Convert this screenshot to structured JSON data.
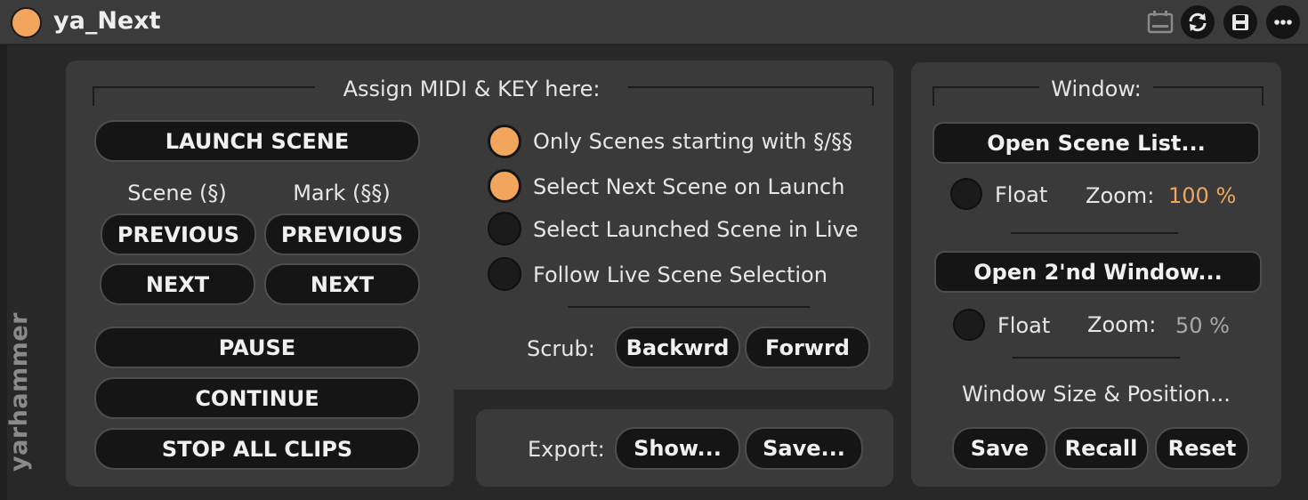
{
  "device": {
    "title": "ya_Next",
    "brand": "yarhammer"
  },
  "colors": {
    "accent": "#f2a55c",
    "panel": "#3a3a3a",
    "background": "#1f1f1f",
    "titlebar": "#3b3b3b"
  },
  "header_icons": [
    {
      "name": "keyboard-icon"
    },
    {
      "name": "sync-icon"
    },
    {
      "name": "save-icon"
    },
    {
      "name": "more-icon"
    }
  ],
  "assign": {
    "heading": "Assign MIDI & KEY here:",
    "launch_scene": "LAUNCH SCENE",
    "scene_label": "Scene (§)",
    "mark_label": "Mark (§§)",
    "scene_previous": "PREVIOUS",
    "scene_next": "NEXT",
    "mark_previous": "PREVIOUS",
    "mark_next": "NEXT",
    "pause": "PAUSE",
    "continue": "CONTINUE",
    "stop_all": "STOP ALL CLIPS"
  },
  "options": [
    {
      "label": "Only Scenes starting with §/§§",
      "checked": true
    },
    {
      "label": "Select Next Scene on Launch",
      "checked": true
    },
    {
      "label": "Select Launched Scene in Live",
      "checked": false
    },
    {
      "label": "Follow Live Scene Selection",
      "checked": false
    }
  ],
  "scrub": {
    "label": "Scrub:",
    "backward": "Backwrd",
    "forward": "Forwrd"
  },
  "export": {
    "label": "Export:",
    "show": "Show...",
    "save": "Save..."
  },
  "window": {
    "heading": "Window:",
    "open_scene_list": "Open Scene List...",
    "float1": "Float",
    "zoom1_label": "Zoom:",
    "zoom1_value": "100 %",
    "open_second": "Open 2'nd Window...",
    "float2": "Float",
    "zoom2_label": "Zoom:",
    "zoom2_value": "50 %",
    "size_pos_label": "Window Size & Position...",
    "save": "Save",
    "recall": "Recall",
    "reset": "Reset"
  }
}
